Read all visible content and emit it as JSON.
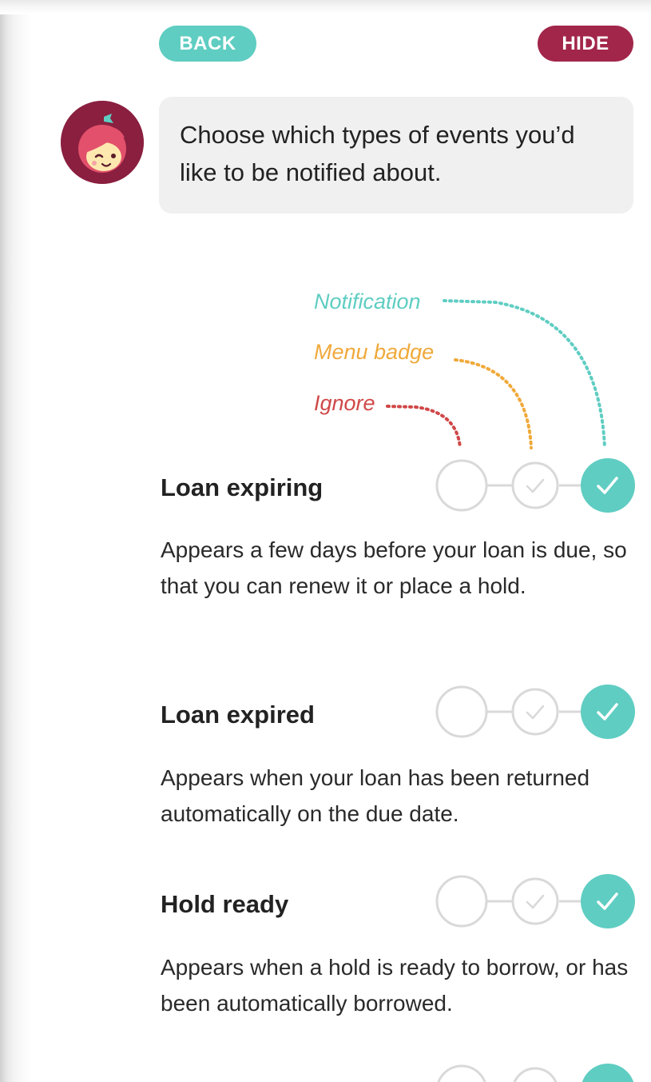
{
  "header": {
    "back_label": "BACK",
    "hide_label": "HIDE"
  },
  "intro": {
    "message": "Choose which types of events you’d like to be notified about."
  },
  "legend": {
    "notification": "Notification",
    "menu_badge": "Menu badge",
    "ignore": "Ignore"
  },
  "colors": {
    "teal": "#5fcdc2",
    "crimson": "#a2264a",
    "orange": "#f0a93a",
    "red": "#d04848",
    "ring_gray": "#d9d9d9"
  },
  "events": [
    {
      "title": "Loan expiring",
      "description": "Appears a few days before your loan is due, so that you can renew it or place a hold.",
      "selected": "notification"
    },
    {
      "title": "Loan expired",
      "description": "Appears when your loan has been returned automatically on the due date.",
      "selected": "notification"
    },
    {
      "title": "Hold ready",
      "description": "Appears when a hold is ready to borrow, or has been automatically borrowed.",
      "selected": "notification"
    },
    {
      "title": "",
      "description": "",
      "selected": "notification"
    }
  ]
}
